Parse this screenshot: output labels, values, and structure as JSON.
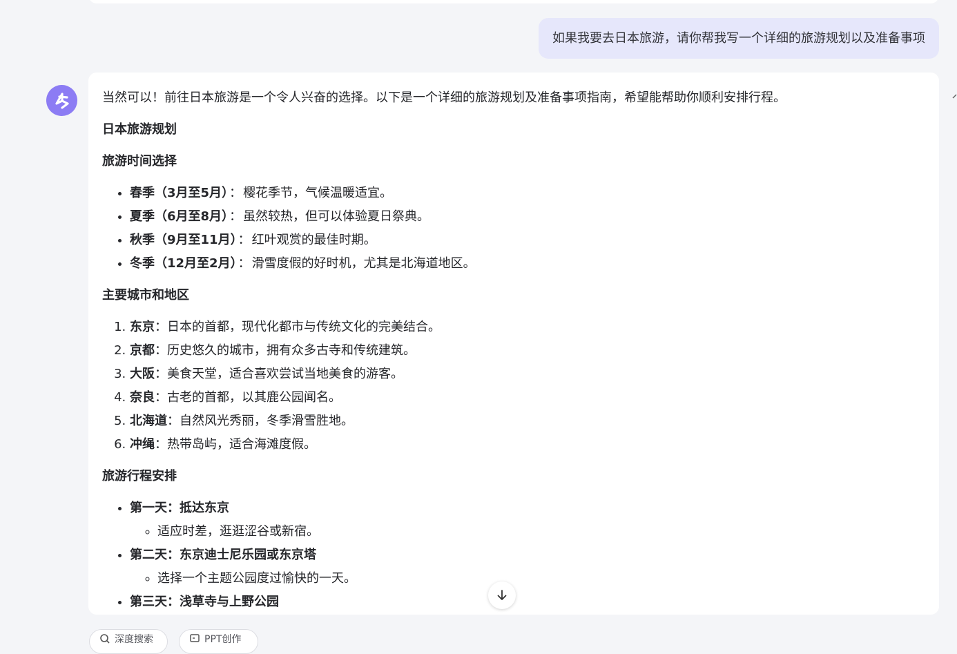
{
  "user_message": "如果我要去日本旅游，请你帮我写一个详细的旅游规划以及准备事项",
  "answer": {
    "intro": "当然可以！前往日本旅游是一个令人兴奋的选择。以下是一个详细的旅游规划及准备事项指南，希望能帮助你顺利安排行程。",
    "title": "日本旅游规划",
    "sections": {
      "time": {
        "heading": "旅游时间选择",
        "items": [
          {
            "label": "春季（3月至5月）",
            "sep": "：",
            "text": "樱花季节，气候温暖适宜。"
          },
          {
            "label": "夏季（6月至8月）",
            "sep": "：",
            "text": "虽然较热，但可以体验夏日祭典。"
          },
          {
            "label": "秋季（9月至11月）",
            "sep": "：",
            "text": "红叶观赏的最佳时期。"
          },
          {
            "label": "冬季（12月至2月）",
            "sep": "：",
            "text": "滑雪度假的好时机，尤其是北海道地区。"
          }
        ]
      },
      "cities": {
        "heading": "主要城市和地区",
        "items": [
          {
            "label": "东京",
            "sep": "：",
            "text": "日本的首都，现代化都市与传统文化的完美结合。"
          },
          {
            "label": "京都",
            "sep": "：",
            "text": "历史悠久的城市，拥有众多古寺和传统建筑。"
          },
          {
            "label": "大阪",
            "sep": "：",
            "text": "美食天堂，适合喜欢尝试当地美食的游客。"
          },
          {
            "label": "奈良",
            "sep": "：",
            "text": "古老的首都，以其鹿公园闻名。"
          },
          {
            "label": "北海道",
            "sep": "：",
            "text": "自然风光秀丽，冬季滑雪胜地。"
          },
          {
            "label": "冲绳",
            "sep": "：",
            "text": "热带岛屿，适合海滩度假。"
          }
        ]
      },
      "itinerary": {
        "heading": "旅游行程安排",
        "days": [
          {
            "title": "第一天：抵达东京",
            "detail": "适应时差，逛逛涩谷或新宿。"
          },
          {
            "title": "第二天：东京迪士尼乐园或东京塔",
            "detail": "选择一个主题公园度过愉快的一天。"
          },
          {
            "title": "第三天：浅草寺与上野公园",
            "detail": ""
          }
        ]
      }
    }
  },
  "actions": {
    "deep_search": "深度搜索",
    "ppt": "PPT创作"
  },
  "colors": {
    "background": "#f4f5f8",
    "user_bubble": "#e6e7fb",
    "avatar": "#8c7cf4"
  }
}
